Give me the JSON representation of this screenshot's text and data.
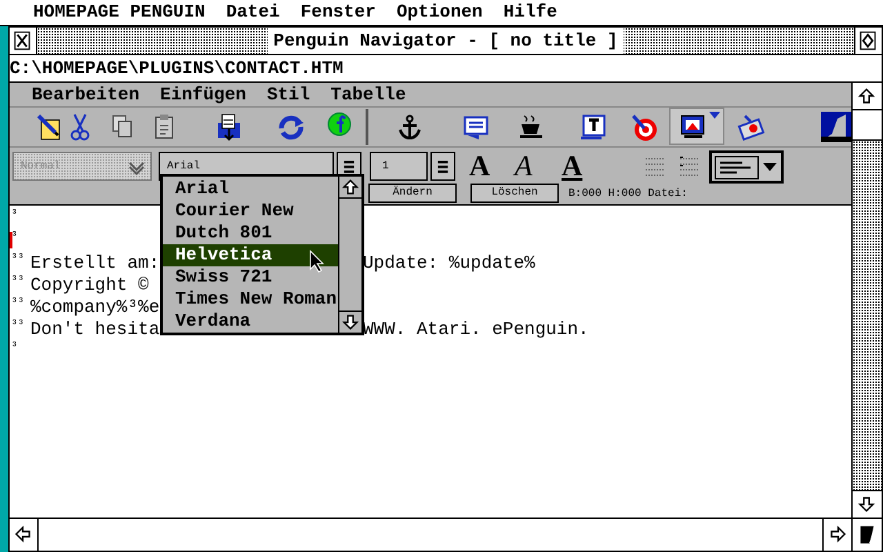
{
  "menu_bar": {
    "app": "HOMEPAGE PENGUIN",
    "items": [
      "Datei",
      "Fenster",
      "Optionen",
      "Hilfe"
    ]
  },
  "window": {
    "title": "Penguin Navigator - [ no title ]",
    "path": "C:\\HOMEPAGE\\PLUGINS\\CONTACT.HTM"
  },
  "menus": [
    "Bearbeiten",
    "Einfügen",
    "Stil",
    "Tabelle"
  ],
  "format_bar": {
    "style_select": {
      "value": "Normal",
      "disabled": true
    },
    "font_field": "Arial",
    "size_field": "1",
    "style_buttons": [
      {
        "kind": "bold",
        "label": "A"
      },
      {
        "kind": "italic",
        "label": "A"
      },
      {
        "kind": "underline",
        "label": "A"
      }
    ]
  },
  "buttons": [
    "Ändern",
    "Löschen"
  ],
  "status": "B:000 H:000 Datei:",
  "font_dropdown": [
    {
      "label": "Arial",
      "selected": false
    },
    {
      "label": "Courier New",
      "selected": false
    },
    {
      "label": "Dutch 801",
      "selected": false
    },
    {
      "label": "Helvetica",
      "selected": true
    },
    {
      "label": "Swiss 721",
      "selected": false
    },
    {
      "label": "Times New Roman",
      "selected": false
    },
    {
      "label": "Verdana",
      "selected": false
    }
  ],
  "document": [
    {
      "marks": "³",
      "cursor": false
    },
    {
      "marks": "³",
      "cursor": true
    },
    {
      "marks": "³³",
      "text": "Erstellt am:",
      "text_after": "Update: %update%",
      "cursor": false
    },
    {
      "marks": "³³",
      "text": "Copyright ©",
      "cursor": false
    },
    {
      "marks": "³³",
      "text": "%company%³%e",
      "cursor": false
    },
    {
      "marks": "³³",
      "text": "Don't hesita",
      "text_after": "WWW. Atari. ePenguin.",
      "cursor": false
    },
    {
      "marks": "³",
      "cursor": false
    }
  ]
}
